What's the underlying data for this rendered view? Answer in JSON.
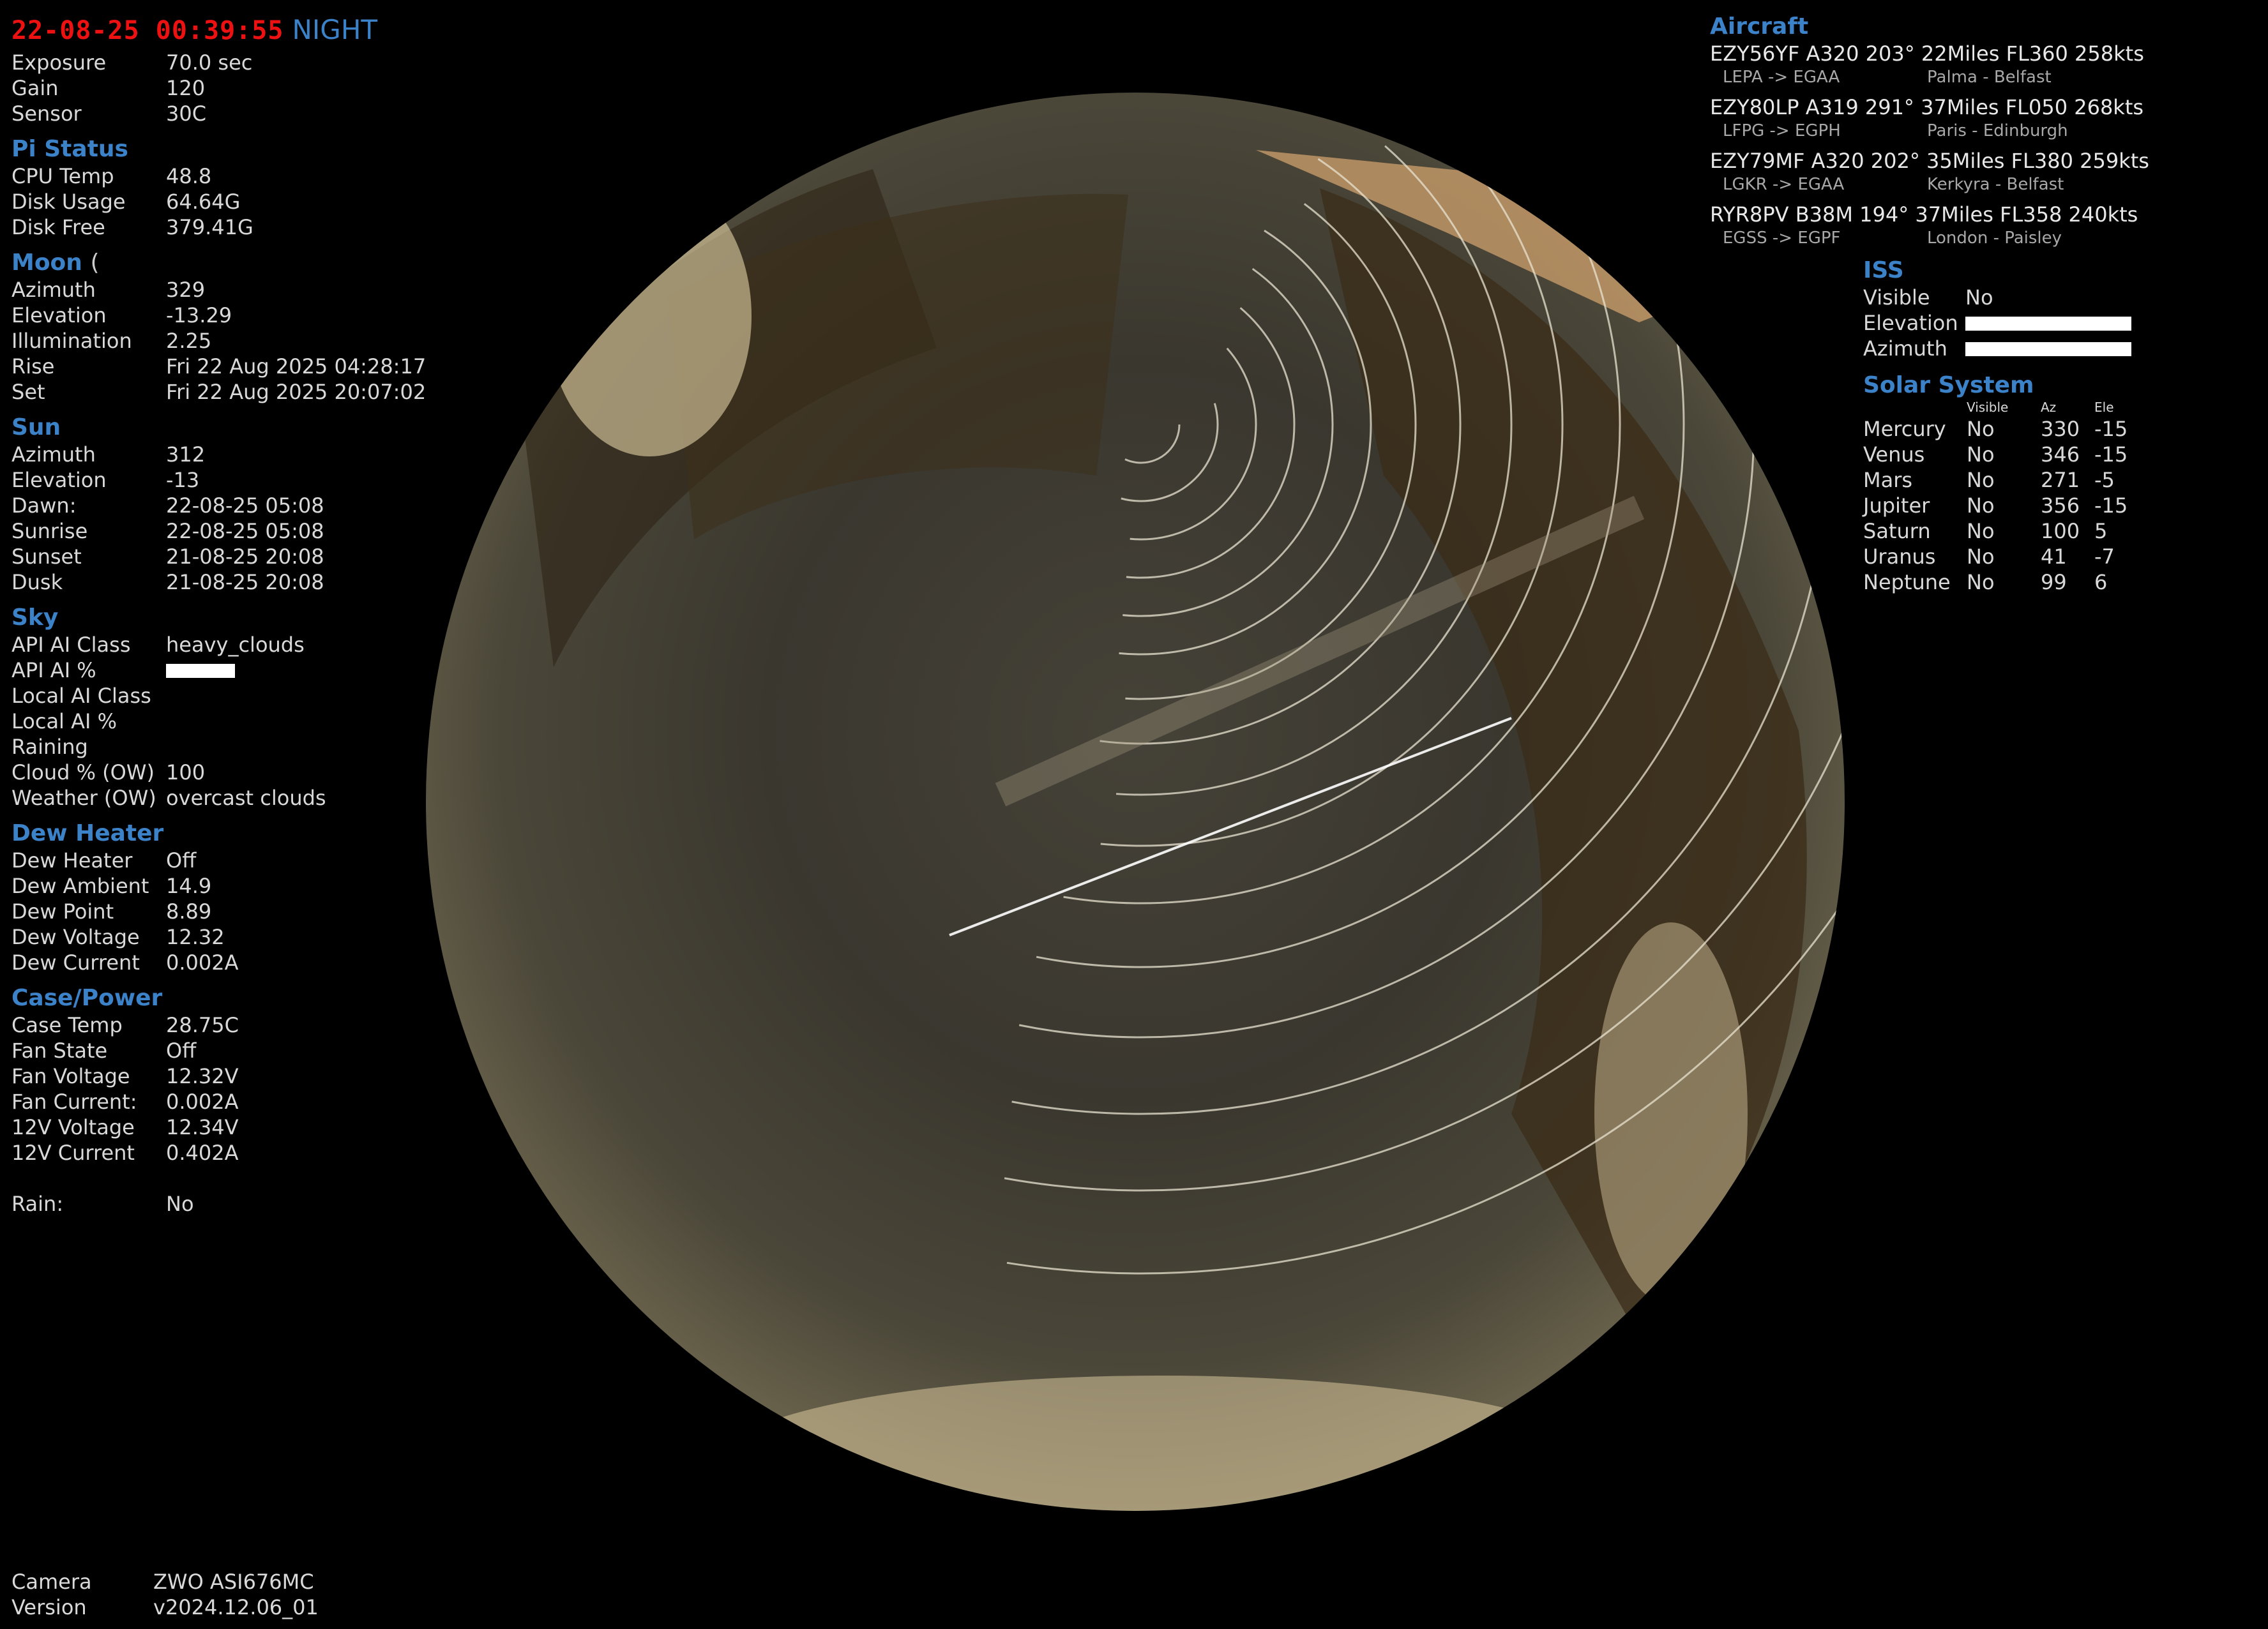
{
  "header": {
    "datetime": "22-08-25 00:39:55",
    "mode": "NIGHT"
  },
  "camera": [
    {
      "label": "Exposure",
      "value": "70.0 sec"
    },
    {
      "label": "Gain",
      "value": "120"
    },
    {
      "label": "Sensor",
      "value": "30C"
    }
  ],
  "pi_status": {
    "title": "Pi Status",
    "rows": [
      {
        "label": "CPU Temp",
        "value": "48.8"
      },
      {
        "label": "Disk Usage",
        "value": "64.64G"
      },
      {
        "label": "Disk Free",
        "value": "379.41G"
      }
    ]
  },
  "moon": {
    "title": "Moon",
    "phase_glyph": "(",
    "rows": [
      {
        "label": "Azimuth",
        "value": "329"
      },
      {
        "label": "Elevation",
        "value": "-13.29"
      },
      {
        "label": "Illumination",
        "value": "2.25"
      },
      {
        "label": "Rise",
        "value": "Fri 22 Aug 2025 04:28:17"
      },
      {
        "label": "Set",
        "value": "Fri 22 Aug 2025 20:07:02"
      }
    ]
  },
  "sun": {
    "title": "Sun",
    "rows": [
      {
        "label": "Azimuth",
        "value": "312"
      },
      {
        "label": "Elevation",
        "value": "-13"
      },
      {
        "label": "Dawn:",
        "value": "22-08-25 05:08"
      },
      {
        "label": "Sunrise",
        "value": "22-08-25 05:08"
      },
      {
        "label": "Sunset",
        "value": "21-08-25 20:08"
      },
      {
        "label": "Dusk",
        "value": "21-08-25 20:08"
      }
    ]
  },
  "sky": {
    "title": "Sky",
    "rows": [
      {
        "label": "API AI Class",
        "value": "heavy_clouds"
      },
      {
        "label": "API AI %",
        "value": ""
      },
      {
        "label": "Local AI Class",
        "value": ""
      },
      {
        "label": "Local AI %",
        "value": ""
      },
      {
        "label": "Raining",
        "value": ""
      },
      {
        "label": "Cloud % (OW)",
        "value": "100"
      },
      {
        "label": "Weather (OW)",
        "value": "overcast clouds"
      }
    ]
  },
  "dew_heater": {
    "title": "Dew Heater",
    "rows": [
      {
        "label": "Dew Heater",
        "value": "Off"
      },
      {
        "label": "Dew Ambient",
        "value": "14.9"
      },
      {
        "label": "Dew Point",
        "value": "8.89"
      },
      {
        "label": "Dew Voltage",
        "value": "12.32"
      },
      {
        "label": "Dew Current",
        "value": "0.002A"
      }
    ]
  },
  "case_power": {
    "title": "Case/Power",
    "rows": [
      {
        "label": "Case Temp",
        "value": "28.75C"
      },
      {
        "label": "Fan State",
        "value": "Off"
      },
      {
        "label": "Fan Voltage",
        "value": "12.32V"
      },
      {
        "label": "Fan Current:",
        "value": "0.002A"
      },
      {
        "label": "12V Voltage",
        "value": "12.34V"
      },
      {
        "label": "12V Current",
        "value": "0.402A"
      }
    ]
  },
  "rain": {
    "label": "Rain:",
    "value": "No"
  },
  "footer": [
    {
      "label": "Camera",
      "value": "ZWO ASI676MC"
    },
    {
      "label": "Version",
      "value": "v2024.12.06_01"
    }
  ],
  "aircraft": {
    "title": "Aircraft",
    "items": [
      {
        "main": "EZY56YF A320 203° 22Miles FL360 258kts",
        "route": "LEPA -> EGAA",
        "from_to": "Palma - Belfast"
      },
      {
        "main": "EZY80LP A319 291° 37Miles FL050 268kts",
        "route": "LFPG -> EGPH",
        "from_to": "Paris - Edinburgh"
      },
      {
        "main": "EZY79MF A320 202° 35Miles FL380 259kts",
        "route": "LGKR -> EGAA",
        "from_to": "Kerkyra - Belfast"
      },
      {
        "main": "RYR8PV B38M 194° 37Miles FL358 240kts",
        "route": "EGSS -> EGPF",
        "from_to": "London - Paisley"
      }
    ]
  },
  "iss": {
    "title": "ISS",
    "rows": [
      {
        "label": "Visible",
        "value": "No"
      },
      {
        "label": "Elevation",
        "value": ""
      },
      {
        "label": "Azimuth",
        "value": ""
      }
    ]
  },
  "solar_system": {
    "title": "Solar System",
    "headers": [
      "Visible",
      "Az",
      "Ele"
    ],
    "rows": [
      {
        "name": "Mercury",
        "visible": "No",
        "az": "330",
        "ele": "-15"
      },
      {
        "name": "Venus",
        "visible": "No",
        "az": "346",
        "ele": "-15"
      },
      {
        "name": "Mars",
        "visible": "No",
        "az": "271",
        "ele": "-5"
      },
      {
        "name": "Jupiter",
        "visible": "No",
        "az": "356",
        "ele": "-15"
      },
      {
        "name": "Saturn",
        "visible": "No",
        "az": "100",
        "ele": "5"
      },
      {
        "name": "Uranus",
        "visible": "No",
        "az": "41",
        "ele": "-7"
      },
      {
        "name": "Neptune",
        "visible": "No",
        "az": "99",
        "ele": "6"
      }
    ]
  },
  "colors": {
    "accent": "#3b82c9",
    "alert": "#e11111",
    "text": "#d9d9d9",
    "background": "#000000"
  }
}
